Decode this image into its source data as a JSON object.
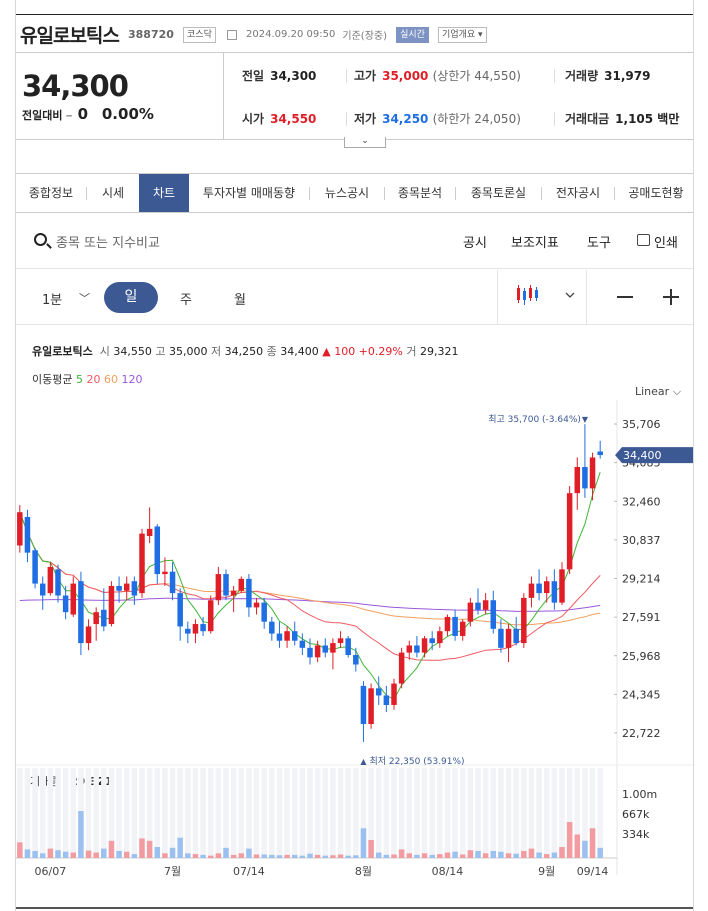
{
  "header": {
    "name": "유일로보틱스",
    "code": "388720",
    "market_badge": "코스닥",
    "datetime": "2024.09.20 09:50",
    "basis": "기준(장중)",
    "realtime_badge": "실시간",
    "overview_badge": "기업개요"
  },
  "price": {
    "current": "34,300",
    "change_label": "전일대비",
    "change_symbol": "━",
    "change_value": "0",
    "change_rate": "0.00%"
  },
  "stats": {
    "prev_label": "전일",
    "prev": "34,300",
    "high_label": "고가",
    "high": "35,000",
    "upper_limit": "(상한가 44,550)",
    "volume_label": "거래량",
    "volume": "31,979",
    "open_label": "시가",
    "open": "34,550",
    "low_label": "저가",
    "low": "34,250",
    "lower_limit": "(하한가 24,050)",
    "amount_label": "거래대금",
    "amount": "1,105 백만"
  },
  "tabs": [
    "종합정보",
    "시세",
    "차트",
    "투자자별 매매동향",
    "뉴스공시",
    "종목분석",
    "종목토론실",
    "전자공시",
    "공매도현황"
  ],
  "active_tab": "차트",
  "search": {
    "placeholder": "종목 또는 지수비교",
    "icon": "search-icon"
  },
  "tools": {
    "disclosure": "공시",
    "indicator": "보조지표",
    "tool": "도구",
    "print": "인쇄"
  },
  "periods": {
    "minute": "1분",
    "day": "일",
    "week": "주",
    "month": "월"
  },
  "chart_info": {
    "name": "유일로보틱스",
    "open_label": "시",
    "open": "34,550",
    "high_label": "고",
    "high": "35,000",
    "low_label": "저",
    "low": "34,250",
    "close_label": "종",
    "close": "34,400",
    "change": "▲ 100 +0.29%",
    "volume_label": "거",
    "volume": "29,321",
    "ma_label": "이동평균",
    "ma5": "5",
    "ma20": "20",
    "ma60": "60",
    "ma120": "120",
    "scale": "Linear"
  },
  "colors": {
    "up": "#e01e28",
    "down": "#1f6ee3",
    "accent": "#3c5993",
    "ma5": "#3fb535",
    "ma20": "#ef5b62",
    "ma60": "#f0a05b",
    "ma120": "#9b57db"
  },
  "chart_data": {
    "type": "candlestick",
    "y_ticks": [
      "35,706",
      "34,083",
      "32,460",
      "30,837",
      "29,214",
      "27,591",
      "25,968",
      "24,345",
      "22,722"
    ],
    "ylim": [
      22722,
      35706
    ],
    "x_labels": [
      "06/07",
      "7월",
      "07/14",
      "8월",
      "08/14",
      "9월",
      "09/14"
    ],
    "current_price_label": "34,400",
    "max_label": "최고 35,700 (-3.64%)",
    "min_label": "최저 22,350 (53.91%)",
    "volume_title": "거래량",
    "volume_value": "29,321",
    "volume_ticks": [
      "1.00m",
      "667k",
      "334k"
    ],
    "candles": [
      [
        30600,
        32300,
        30300,
        32000
      ],
      [
        31800,
        32100,
        29900,
        30300
      ],
      [
        30400,
        30500,
        28800,
        29000
      ],
      [
        29000,
        29300,
        27900,
        28500
      ],
      [
        28600,
        29900,
        28500,
        29700
      ],
      [
        29600,
        29800,
        28200,
        28500
      ],
      [
        28500,
        28900,
        27500,
        27800
      ],
      [
        27700,
        29300,
        27600,
        29000
      ],
      [
        29100,
        29500,
        26000,
        26500
      ],
      [
        26500,
        27500,
        26200,
        27200
      ],
      [
        27300,
        28000,
        26600,
        27800
      ],
      [
        27900,
        28800,
        27000,
        27200
      ],
      [
        27300,
        29100,
        27200,
        28900
      ],
      [
        28900,
        29300,
        28200,
        28700
      ],
      [
        28700,
        29300,
        28300,
        29000
      ],
      [
        29100,
        29300,
        28100,
        28500
      ],
      [
        28600,
        31300,
        28400,
        31100
      ],
      [
        31000,
        32200,
        30700,
        31300
      ],
      [
        31400,
        31500,
        29000,
        29400
      ],
      [
        29400,
        30100,
        28900,
        29500
      ],
      [
        29500,
        29900,
        28300,
        28600
      ],
      [
        28600,
        28800,
        26600,
        27200
      ],
      [
        27100,
        27400,
        26500,
        26900
      ],
      [
        26900,
        27500,
        26500,
        27300
      ],
      [
        27300,
        27600,
        26800,
        27000
      ],
      [
        27000,
        28500,
        26900,
        28300
      ],
      [
        28300,
        29700,
        28100,
        29400
      ],
      [
        29400,
        29600,
        28300,
        28500
      ],
      [
        28500,
        28900,
        27800,
        28700
      ],
      [
        28700,
        29300,
        28600,
        29200
      ],
      [
        29200,
        29400,
        27600,
        28000
      ],
      [
        28000,
        28400,
        27700,
        28200
      ],
      [
        28200,
        28400,
        27100,
        27400
      ],
      [
        27400,
        27600,
        26600,
        26900
      ],
      [
        26900,
        27400,
        26300,
        26600
      ],
      [
        26600,
        27200,
        26300,
        27000
      ],
      [
        27000,
        27400,
        26400,
        26600
      ],
      [
        26600,
        26900,
        26000,
        26300
      ],
      [
        26300,
        26700,
        25600,
        25900
      ],
      [
        25900,
        26600,
        25700,
        26400
      ],
      [
        26400,
        26700,
        25900,
        26100
      ],
      [
        26100,
        26700,
        25400,
        26500
      ],
      [
        26500,
        27000,
        26300,
        26700
      ],
      [
        26700,
        26800,
        25900,
        26000
      ],
      [
        26000,
        26300,
        25300,
        25600
      ],
      [
        24700,
        24900,
        22350,
        23100
      ],
      [
        23100,
        24800,
        22900,
        24600
      ],
      [
        24600,
        25100,
        23900,
        24300
      ],
      [
        24300,
        24700,
        23600,
        23900
      ],
      [
        23900,
        25000,
        23700,
        24800
      ],
      [
        24800,
        26300,
        24600,
        26100
      ],
      [
        26100,
        26600,
        25800,
        26400
      ],
      [
        26400,
        26800,
        25900,
        26100
      ],
      [
        26100,
        26800,
        25900,
        26700
      ],
      [
        26700,
        27000,
        26200,
        26500
      ],
      [
        26500,
        27200,
        26300,
        27000
      ],
      [
        27000,
        27700,
        26800,
        27600
      ],
      [
        27600,
        27900,
        26600,
        26800
      ],
      [
        26800,
        27500,
        26600,
        27400
      ],
      [
        27400,
        28400,
        27200,
        28200
      ],
      [
        28200,
        28800,
        27700,
        27900
      ],
      [
        27900,
        28600,
        27700,
        28300
      ],
      [
        28300,
        28700,
        26900,
        27100
      ],
      [
        27100,
        27500,
        26100,
        26300
      ],
      [
        26300,
        27300,
        25700,
        27100
      ],
      [
        27100,
        27600,
        26400,
        26500
      ],
      [
        26500,
        28600,
        26300,
        28400
      ],
      [
        28400,
        29300,
        28000,
        29000
      ],
      [
        29000,
        29600,
        28300,
        28600
      ],
      [
        28600,
        29300,
        28200,
        29100
      ],
      [
        29100,
        29600,
        27900,
        28200
      ],
      [
        28200,
        29900,
        28100,
        29600
      ],
      [
        29600,
        33100,
        29400,
        32800
      ],
      [
        32800,
        34300,
        32100,
        33900
      ],
      [
        33900,
        35700,
        32600,
        33000
      ],
      [
        33000,
        34500,
        32500,
        34300
      ],
      [
        34550,
        35000,
        34250,
        34400
      ]
    ],
    "volumes": [
      200,
      110,
      90,
      60,
      120,
      100,
      80,
      70,
      600,
      95,
      70,
      120,
      220,
      90,
      80,
      50,
      250,
      220,
      140,
      60,
      130,
      260,
      60,
      50,
      40,
      30,
      60,
      130,
      40,
      60,
      120,
      45,
      45,
      40,
      35,
      40,
      40,
      30,
      55,
      40,
      30,
      35,
      45,
      30,
      35,
      380,
      230,
      70,
      40,
      45,
      110,
      60,
      40,
      60,
      40,
      50,
      70,
      80,
      45,
      100,
      90,
      60,
      90,
      80,
      60,
      55,
      90,
      120,
      70,
      50,
      70,
      140,
      460,
      300,
      220,
      380,
      130
    ]
  }
}
